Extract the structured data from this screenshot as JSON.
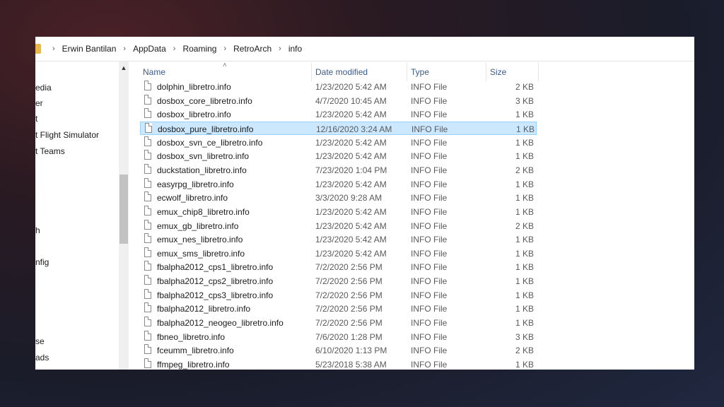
{
  "breadcrumb": [
    "Erwin Bantilan",
    "AppData",
    "Roaming",
    "RetroArch",
    "info"
  ],
  "nav_items": [
    "edia",
    "er",
    "t",
    "t Flight Simulator",
    "t Teams",
    "h",
    "nfig",
    "se",
    "ads"
  ],
  "columns": {
    "name": "Name",
    "date": "Date modified",
    "type": "Type",
    "size": "Size"
  },
  "files": [
    {
      "name": "dolphin_libretro.info",
      "date": "1/23/2020 5:42 AM",
      "type": "INFO File",
      "size": "2 KB"
    },
    {
      "name": "dosbox_core_libretro.info",
      "date": "4/7/2020 10:45 AM",
      "type": "INFO File",
      "size": "3 KB"
    },
    {
      "name": "dosbox_libretro.info",
      "date": "1/23/2020 5:42 AM",
      "type": "INFO File",
      "size": "1 KB"
    },
    {
      "name": "dosbox_pure_libretro.info",
      "date": "12/16/2020 3:24 AM",
      "type": "INFO File",
      "size": "1 KB",
      "selected": true
    },
    {
      "name": "dosbox_svn_ce_libretro.info",
      "date": "1/23/2020 5:42 AM",
      "type": "INFO File",
      "size": "1 KB"
    },
    {
      "name": "dosbox_svn_libretro.info",
      "date": "1/23/2020 5:42 AM",
      "type": "INFO File",
      "size": "1 KB"
    },
    {
      "name": "duckstation_libretro.info",
      "date": "7/23/2020 1:04 PM",
      "type": "INFO File",
      "size": "2 KB"
    },
    {
      "name": "easyrpg_libretro.info",
      "date": "1/23/2020 5:42 AM",
      "type": "INFO File",
      "size": "1 KB"
    },
    {
      "name": "ecwolf_libretro.info",
      "date": "3/3/2020 9:28 AM",
      "type": "INFO File",
      "size": "1 KB"
    },
    {
      "name": "emux_chip8_libretro.info",
      "date": "1/23/2020 5:42 AM",
      "type": "INFO File",
      "size": "1 KB"
    },
    {
      "name": "emux_gb_libretro.info",
      "date": "1/23/2020 5:42 AM",
      "type": "INFO File",
      "size": "2 KB"
    },
    {
      "name": "emux_nes_libretro.info",
      "date": "1/23/2020 5:42 AM",
      "type": "INFO File",
      "size": "1 KB"
    },
    {
      "name": "emux_sms_libretro.info",
      "date": "1/23/2020 5:42 AM",
      "type": "INFO File",
      "size": "1 KB"
    },
    {
      "name": "fbalpha2012_cps1_libretro.info",
      "date": "7/2/2020 2:56 PM",
      "type": "INFO File",
      "size": "1 KB"
    },
    {
      "name": "fbalpha2012_cps2_libretro.info",
      "date": "7/2/2020 2:56 PM",
      "type": "INFO File",
      "size": "1 KB"
    },
    {
      "name": "fbalpha2012_cps3_libretro.info",
      "date": "7/2/2020 2:56 PM",
      "type": "INFO File",
      "size": "1 KB"
    },
    {
      "name": "fbalpha2012_libretro.info",
      "date": "7/2/2020 2:56 PM",
      "type": "INFO File",
      "size": "1 KB"
    },
    {
      "name": "fbalpha2012_neogeo_libretro.info",
      "date": "7/2/2020 2:56 PM",
      "type": "INFO File",
      "size": "1 KB"
    },
    {
      "name": "fbneo_libretro.info",
      "date": "7/6/2020 1:28 PM",
      "type": "INFO File",
      "size": "3 KB"
    },
    {
      "name": "fceumm_libretro.info",
      "date": "6/10/2020 1:13 PM",
      "type": "INFO File",
      "size": "2 KB"
    },
    {
      "name": "ffmpeg_libretro.info",
      "date": "5/23/2018 5:38 AM",
      "type": "INFO File",
      "size": "1 KB"
    }
  ]
}
